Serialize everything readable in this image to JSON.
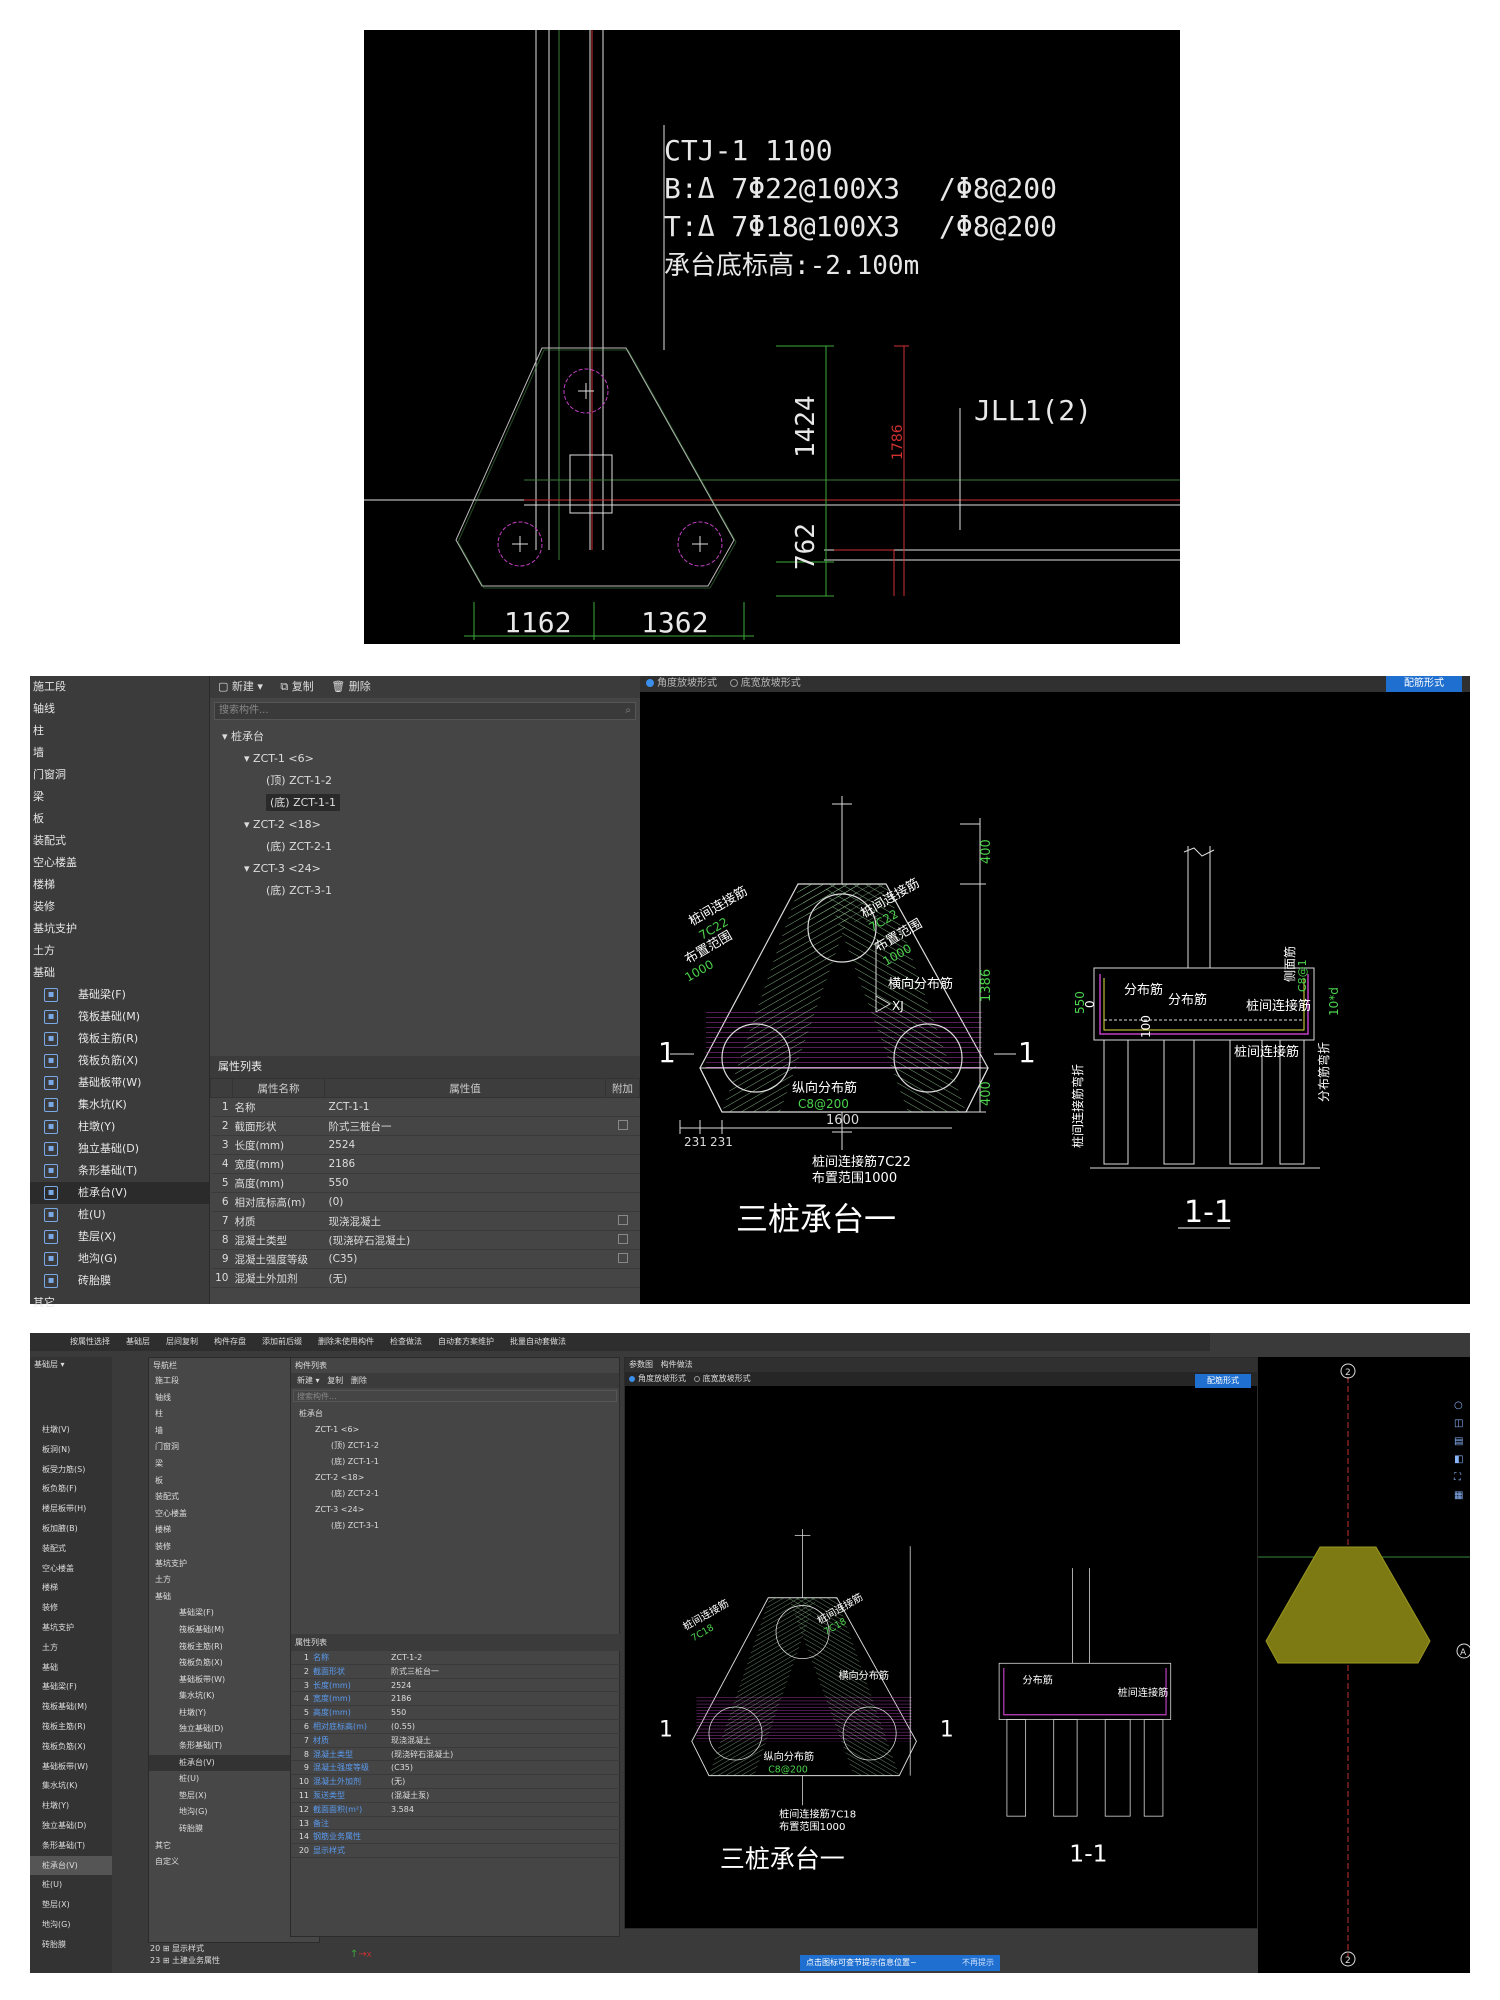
{
  "cad_top": {
    "label_ctj": "CTJ-1 1100",
    "label_b": "B:Δ 7Φ22@100X3",
    "label_b2": "/Φ8@200",
    "label_t": "T:Δ 7Φ18@100X3",
    "label_t2": "/Φ8@200",
    "label_elev": "承台底标高:-2.100m",
    "dim_1424": "1424",
    "dim_1786": "1786",
    "dim_762": "762",
    "dim_1162": "1162",
    "dim_1362": "1362",
    "label_jll": "JLL1(2)"
  },
  "app_mid": {
    "nav_top": [
      "施工段",
      "轴线",
      "柱",
      "墙",
      "门窗洞",
      "梁",
      "板",
      "装配式",
      "空心楼盖",
      "楼梯",
      "装修",
      "基坑支护",
      "土方",
      "基础"
    ],
    "nav_sub": [
      {
        "label": "基础梁(F)",
        "icon": "beam-icon"
      },
      {
        "label": "筏板基础(M)",
        "icon": "raft-icon"
      },
      {
        "label": "筏板主筋(R)",
        "icon": "rebar-icon"
      },
      {
        "label": "筏板负筋(X)",
        "icon": "rebar-neg-icon"
      },
      {
        "label": "基础板带(W)",
        "icon": "band-icon"
      },
      {
        "label": "集水坑(K)",
        "icon": "pit-icon"
      },
      {
        "label": "柱墩(Y)",
        "icon": "pier-icon"
      },
      {
        "label": "独立基础(D)",
        "icon": "isolated-footing-icon"
      },
      {
        "label": "条形基础(T)",
        "icon": "strip-footing-icon"
      },
      {
        "label": "桩承台(V)",
        "icon": "pile-cap-icon"
      },
      {
        "label": "桩(U)",
        "icon": "pile-icon"
      },
      {
        "label": "垫层(X)",
        "icon": "cushion-icon"
      },
      {
        "label": "地沟(G)",
        "icon": "trench-icon"
      },
      {
        "label": "砖胎膜",
        "icon": "brick-mold-icon"
      }
    ],
    "nav_bottom": "其它",
    "toolbar": {
      "new": "新建",
      "copy": "复制",
      "delete": "删除"
    },
    "search_placeholder": "搜索构件...",
    "tree": [
      {
        "label": "桩承台",
        "level": 0
      },
      {
        "label": "ZCT-1 <6>",
        "level": 1
      },
      {
        "label": "(顶) ZCT-1-2",
        "level": 2
      },
      {
        "label": "(底) ZCT-1-1",
        "level": 2,
        "selected": true
      },
      {
        "label": "ZCT-2 <18>",
        "level": 1
      },
      {
        "label": "(底) ZCT-2-1",
        "level": 2
      },
      {
        "label": "ZCT-3 <24>",
        "level": 1
      },
      {
        "label": "(底) ZCT-3-1",
        "level": 2
      }
    ],
    "props_title": "属性列表",
    "props_headers": [
      "属性名称",
      "属性值",
      "附加"
    ],
    "props": [
      {
        "n": "1",
        "k": "名称",
        "v": "ZCT-1-1",
        "c": false
      },
      {
        "n": "2",
        "k": "截面形状",
        "v": "阶式三桩台一",
        "c": true
      },
      {
        "n": "3",
        "k": "长度(mm)",
        "v": "2524",
        "c": false
      },
      {
        "n": "4",
        "k": "宽度(mm)",
        "v": "2186",
        "c": false
      },
      {
        "n": "5",
        "k": "高度(mm)",
        "v": "550",
        "c": false
      },
      {
        "n": "6",
        "k": "相对底标高(m)",
        "v": "(0)",
        "c": false
      },
      {
        "n": "7",
        "k": "材质",
        "v": "现浇混凝土",
        "c": true
      },
      {
        "n": "8",
        "k": "混凝土类型",
        "v": "(现浇碎石混凝土)",
        "c": true
      },
      {
        "n": "9",
        "k": "混凝土强度等级",
        "v": "(C35)",
        "c": true
      },
      {
        "n": "10",
        "k": "混凝土外加剂",
        "v": "(无)",
        "c": false
      }
    ],
    "radio_1": "角度放坡形式",
    "radio_2": "底宽放坡形式",
    "rebar_form_btn": "配筋形式",
    "drawing": {
      "title": "三桩承台一",
      "section_title": "1-1",
      "sec_mark": "1",
      "lbl_pile_conn": "桩间连接筋",
      "lbl_7c22": "7C22",
      "lbl_range": "布置范围",
      "lbl_1000": "1000",
      "lbl_horiz": "横向分布筋",
      "lbl_xj": "XJ",
      "lbl_long": "纵向分布筋",
      "lbl_c8200": "C8@200",
      "lbl_bottom_conn": "桩间连接筋7C22",
      "lbl_range_bottom": "布置范围1000",
      "dim_400a": "400",
      "dim_1386": "1386",
      "dim_400b": "400",
      "dim_1600": "1600",
      "dim_231a": "231",
      "dim_231b": "231",
      "sec_dist1": "分布筋",
      "sec_dist2": "分布筋",
      "sec_conn": "桩间连接筋",
      "sec_conn2": "桩间连接筋",
      "sec_side": "侧面筋",
      "sec_c8": "C8@1",
      "sec_550": "550",
      "sec_0": "0",
      "sec_100": "100",
      "sec_10d": "10*d",
      "sec_bend": "桩间连接筋弯折",
      "sec_dist_bend": "分布筋弯折"
    }
  },
  "app_bot": {
    "ribbon": [
      "按属性选择",
      "基础层",
      "层间复制",
      "构件存盘",
      "添加前后缀",
      "删除未使用构件",
      "检查做法",
      "自动套方案维护",
      "批量自动套做法"
    ],
    "left_nav": [
      "柱墩(V)",
      "板洞(N)",
      "板受力筋(S)",
      "板负筋(F)",
      "楼层板带(H)",
      "板加腋(B)",
      "装配式",
      "空心楼盖",
      "楼梯",
      "装修",
      "基坑支护",
      "土方",
      "基础",
      "基础梁(F)",
      "筏板基础(M)",
      "筏板主筋(R)",
      "筏板负筋(X)",
      "基础板带(W)",
      "集水坑(K)",
      "柱墩(Y)",
      "独立基础(D)",
      "条形基础(T)",
      "桩承台(V)",
      "桩(U)",
      "垫层(X)",
      "地沟(G)",
      "砖胎膜"
    ],
    "popup_nav": [
      "施工段",
      "轴线",
      "柱",
      "墙",
      "门窗洞",
      "梁",
      "板",
      "装配式",
      "空心楼盖",
      "楼梯",
      "装修",
      "基坑支护",
      "土方",
      "基础",
      "基础梁(F)",
      "筏板基础(M)",
      "筏板主筋(R)",
      "筏板负筋(X)",
      "基础板带(W)",
      "集水坑(K)",
      "柱墩(Y)",
      "独立基础(D)",
      "条形基础(T)",
      "桩承台(V)",
      "桩(U)",
      "垫层(X)",
      "地沟(G)",
      "砖胎膜",
      "其它",
      "自定义"
    ],
    "nav_title": "导航栏",
    "comp_title": "构件列表",
    "tree": [
      "桩承台",
      "ZCT-1 <6>",
      "(顶) ZCT-1-2",
      "(底) ZCT-1-1",
      "ZCT-2 <18>",
      "(底) ZCT-2-1",
      "ZCT-3 <24>",
      "(底) ZCT-3-1"
    ],
    "props": [
      {
        "n": "1",
        "k": "名称",
        "v": "ZCT-1-2"
      },
      {
        "n": "2",
        "k": "截面形状",
        "v": "阶式三桩台一"
      },
      {
        "n": "3",
        "k": "长度(mm)",
        "v": "2524"
      },
      {
        "n": "4",
        "k": "宽度(mm)",
        "v": "2186"
      },
      {
        "n": "5",
        "k": "高度(mm)",
        "v": "550"
      },
      {
        "n": "6",
        "k": "相对底标高(m)",
        "v": "(0.55)"
      },
      {
        "n": "7",
        "k": "材质",
        "v": "现浇混凝土"
      },
      {
        "n": "8",
        "k": "混凝土类型",
        "v": "(现浇碎石混凝土)"
      },
      {
        "n": "9",
        "k": "混凝土强度等级",
        "v": "(C35)"
      },
      {
        "n": "10",
        "k": "混凝土外加剂",
        "v": "(无)"
      },
      {
        "n": "11",
        "k": "泵送类型",
        "v": "(混凝土泵)"
      },
      {
        "n": "12",
        "k": "截面面积(m²)",
        "v": "3.584"
      },
      {
        "n": "13",
        "k": "备注",
        "v": ""
      },
      {
        "n": "14",
        "k": "钢筋业务属性",
        "v": ""
      },
      {
        "n": "20",
        "k": "显示样式",
        "v": ""
      }
    ],
    "extra_row_1": "显示样式",
    "extra_row_2": "土建业务属性",
    "tabs": [
      "参数图",
      "构件做法"
    ],
    "drawing": {
      "title": "三桩承台一",
      "section_title": "1-1",
      "lbl_7c18": "7C18",
      "lbl_bottom_conn": "桩间连接筋7C18",
      "lbl_range_bottom": "布置范围1000",
      "lbl_c8200": "C8@200"
    },
    "axis_2": "2",
    "axis_a": "A",
    "status_msg": "点击图标可查节提示信息位置~",
    "status_btn": "不再提示",
    "shape_color": "#7d7a14"
  }
}
